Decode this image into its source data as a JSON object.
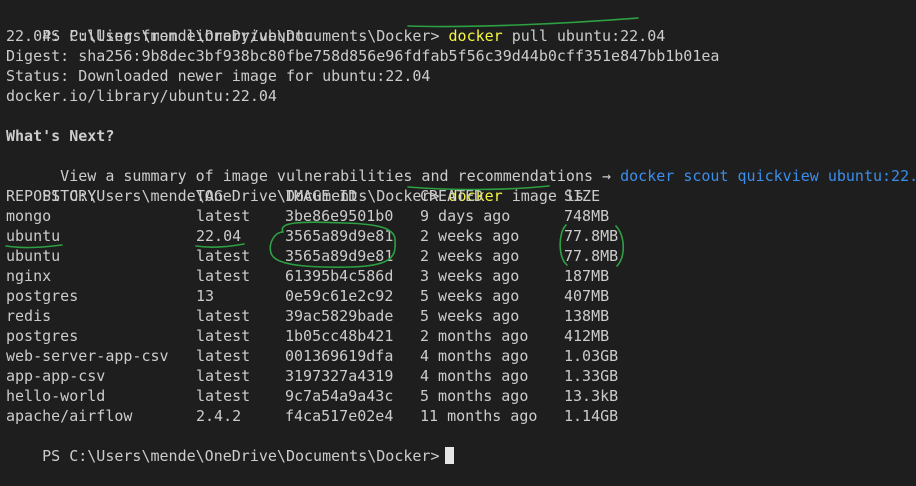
{
  "prompt": "PS C:\\Users\\mende\\OneDrive\\Documents\\Docker>",
  "cmd1": {
    "keyword": "docker",
    "args": "pull ubuntu:22.04"
  },
  "pull_output": [
    "22.04: Pulling from library/ubuntu",
    "Digest: sha256:9b8dec3bf938bc80fbe758d856e96fdfab5f56c39d44b0cff351e847bb1b01ea",
    "Status: Downloaded newer image for ubuntu:22.04",
    "docker.io/library/ubuntu:22.04"
  ],
  "whats_next": {
    "heading": "What's Next?",
    "text": "  View a summary of image vulnerabilities and recommendations →",
    "command": "docker scout quickview ubuntu:22.04"
  },
  "cmd2": {
    "keyword": "docker",
    "args": "image ls"
  },
  "table": {
    "headers": [
      "REPOSITORY",
      "TAG",
      "IMAGE ID",
      "CREATED",
      "SIZE"
    ],
    "rows": [
      [
        "mongo",
        "latest",
        "3be86e9501b0",
        "9 days ago",
        "748MB"
      ],
      [
        "ubuntu",
        "22.04",
        "3565a89d9e81",
        "2 weeks ago",
        "77.8MB"
      ],
      [
        "ubuntu",
        "latest",
        "3565a89d9e81",
        "2 weeks ago",
        "77.8MB"
      ],
      [
        "nginx",
        "latest",
        "61395b4c586d",
        "3 weeks ago",
        "187MB"
      ],
      [
        "postgres",
        "13",
        "0e59c61e2c92",
        "5 weeks ago",
        "407MB"
      ],
      [
        "redis",
        "latest",
        "39ac5829bade",
        "5 weeks ago",
        "138MB"
      ],
      [
        "postgres",
        "latest",
        "1b05cc48b421",
        "2 months ago",
        "412MB"
      ],
      [
        "web-server-app-csv",
        "latest",
        "001369619dfa",
        "4 months ago",
        "1.03GB"
      ],
      [
        "app-app-csv",
        "latest",
        "3197327a4319",
        "4 months ago",
        "1.33GB"
      ],
      [
        "hello-world",
        "latest",
        "9c7a54a9a43c",
        "5 months ago",
        "13.3kB"
      ],
      [
        "apache/airflow",
        "2.4.2",
        "f4ca517e02e4",
        "11 months ago",
        "1.14GB"
      ]
    ]
  },
  "colors": {
    "background": "#1e1e1e",
    "foreground": "#cccccc",
    "command_yellow": "#f5f543",
    "link_blue": "#3b8eea",
    "annotation_green": "#2ea043"
  }
}
